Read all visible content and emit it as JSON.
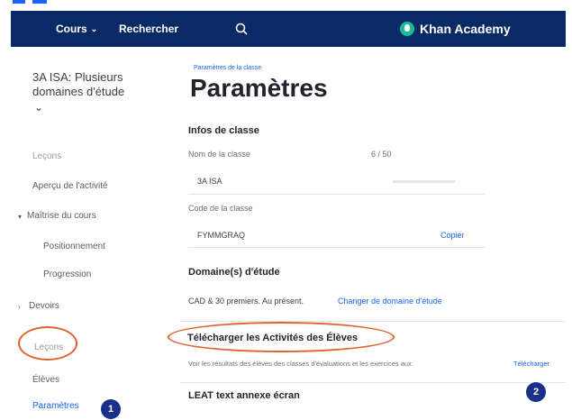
{
  "navbar": {
    "courses_label": "Cours",
    "search_label": "Rechercher",
    "brand": "Khan Academy"
  },
  "sidebar": {
    "class_name": "3A ISA: Plusieurs domaines d'étude",
    "items": [
      {
        "label": "Leçons"
      },
      {
        "label": "Aperçu de l'activité"
      },
      {
        "label": "Maîtrise du cours"
      },
      {
        "label": "Positionnement"
      },
      {
        "label": "Progression"
      },
      {
        "label": "Devoirs"
      },
      {
        "label": "Leçons"
      },
      {
        "label": "Élèves"
      },
      {
        "label": "Paramètres"
      }
    ]
  },
  "main": {
    "breadcrumb": "Paramètres de la classe",
    "title": "Paramètres",
    "class_info": {
      "heading": "Infos de classe",
      "name_label": "Nom de la classe",
      "name_count": "6 / 50",
      "name_value": "3A ISA",
      "code_label": "Code de la classe",
      "code_value": "FYMMGRAQ",
      "copy_label": "Copier"
    },
    "domains": {
      "heading": "Domaine(s) d'étude",
      "value": "CAD & 30 premiers. Au présent.",
      "change_link": "Changer de domaine d'étude"
    },
    "download": {
      "heading": "Télécharger les Activités des Élèves",
      "description": "Voir les résultats des élèves des classes d'évaluations et les exercices aux.",
      "link": "Télécharger"
    },
    "next": {
      "heading": "LEAT text annexe écran"
    }
  },
  "annotations": {
    "badge1": "1",
    "badge2": "2",
    "accent": "#e0632d",
    "badge_color": "#1a2f87"
  },
  "colors": {
    "nav_bg": "#0a2a66",
    "link": "#1865f2",
    "brand_leaf": "#14bf96"
  }
}
